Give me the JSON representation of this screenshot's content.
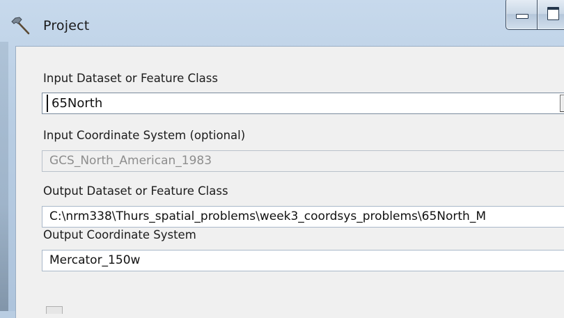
{
  "window": {
    "title": "Project"
  },
  "form": {
    "input_dataset": {
      "label": "Input Dataset or Feature Class",
      "value": "65North"
    },
    "input_coord": {
      "label": "Input Coordinate System (optional)",
      "value": "GCS_North_American_1983"
    },
    "output_dataset": {
      "label": "Output Dataset or Feature Class",
      "value": "C:\\nrm338\\Thurs_spatial_problems\\week3_coordsys_problems\\65North_M"
    },
    "output_coord": {
      "label": "Output Coordinate System",
      "value": "Mercator_150w"
    }
  },
  "icons": {
    "app": "hammer-icon",
    "minimize": "minimize-icon",
    "maximize": "maximize-icon",
    "dropdown": "chevron-down-icon"
  }
}
